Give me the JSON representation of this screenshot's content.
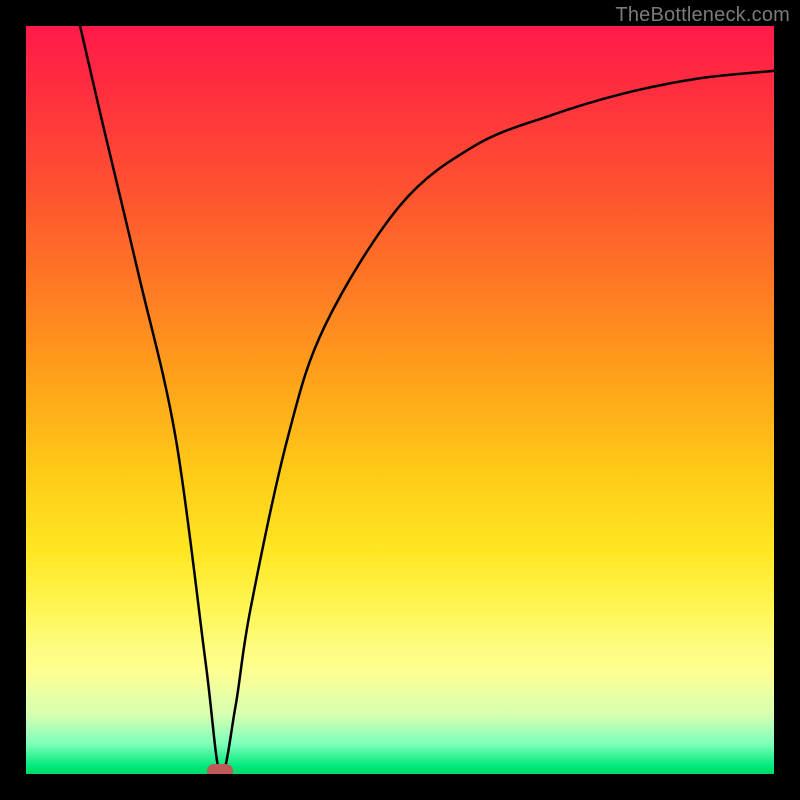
{
  "watermark": "TheBottleneck.com",
  "chart_data": {
    "type": "line",
    "title": "",
    "xlabel": "",
    "ylabel": "",
    "xlim": [
      0,
      100
    ],
    "ylim": [
      0,
      100
    ],
    "grid": false,
    "legend": false,
    "background": {
      "type": "vertical-gradient",
      "stops": [
        {
          "pct": 0,
          "color": "#ff1a4a"
        },
        {
          "pct": 50,
          "color": "#ffcf1a"
        },
        {
          "pct": 85,
          "color": "#fdff99"
        },
        {
          "pct": 100,
          "color": "#00d868"
        }
      ]
    },
    "series": [
      {
        "name": "bottleneck-curve",
        "x": [
          7,
          10,
          15,
          20,
          24,
          26,
          28,
          30,
          35,
          40,
          50,
          60,
          70,
          80,
          90,
          100
        ],
        "y": [
          101,
          88,
          67,
          45,
          15,
          0,
          9,
          22,
          45,
          60,
          76,
          84,
          88,
          91,
          93,
          94
        ]
      }
    ],
    "marker": {
      "x": 26,
      "y": 0,
      "color": "#bf5a58",
      "shape": "rounded-rect"
    }
  }
}
